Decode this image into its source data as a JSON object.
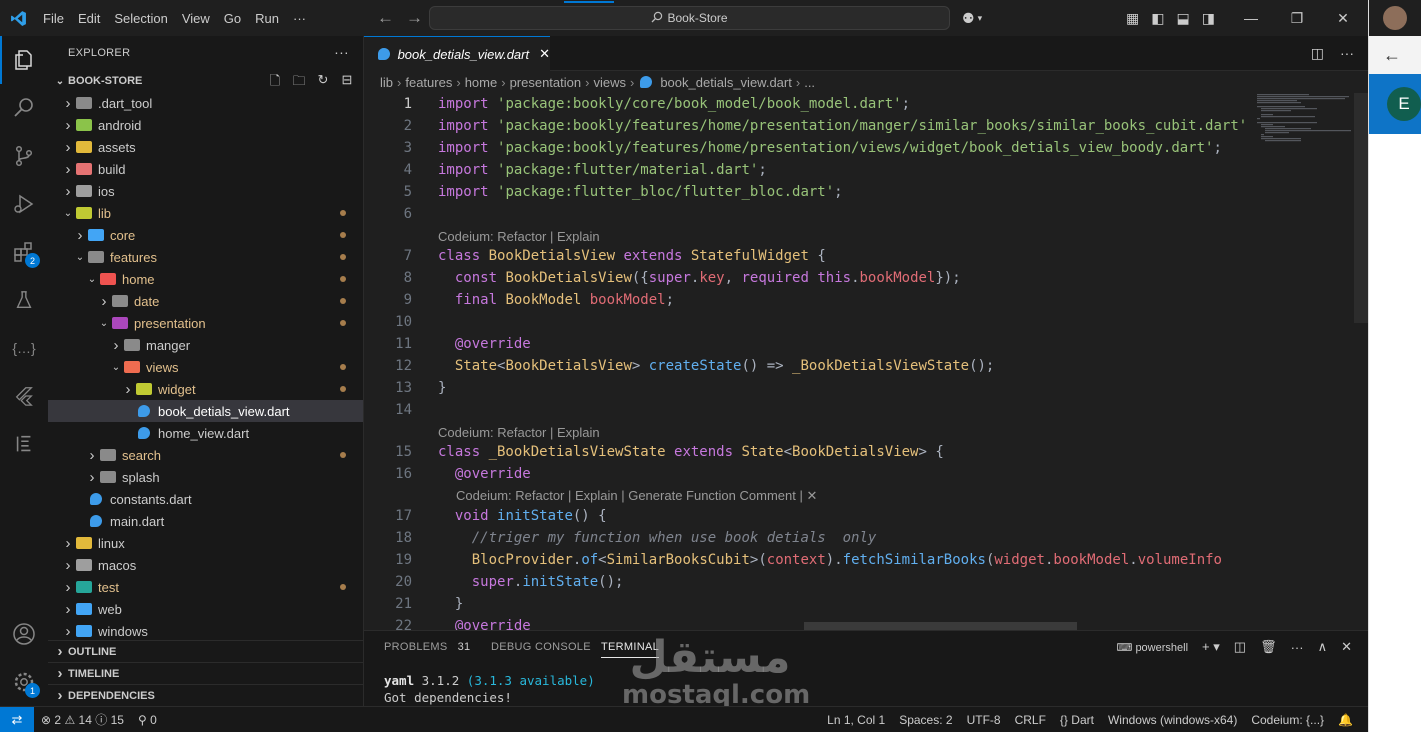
{
  "titlebar": {
    "menus": [
      "File",
      "Edit",
      "Selection",
      "View",
      "Go",
      "Run",
      "···"
    ],
    "search_text": "Book-Store"
  },
  "activity_bar": {
    "items": [
      "explorer-icon",
      "search-icon",
      "source-control-icon",
      "run-debug-icon",
      "extensions-icon",
      "testing-icon",
      "json-icon",
      "flutter-icon",
      "outline-icon"
    ],
    "extensions_badge": "2",
    "settings_badge": "1"
  },
  "sidebar": {
    "title": "EXPLORER",
    "project": "BOOK-STORE",
    "tree": [
      {
        "label": ".dart_tool",
        "depth": 0,
        "type": "folder",
        "expanded": false,
        "color": "#8a8a8a",
        "dot": false
      },
      {
        "label": "android",
        "depth": 0,
        "type": "folder",
        "expanded": false,
        "color": "#8bc34a",
        "dot": false
      },
      {
        "label": "assets",
        "depth": 0,
        "type": "folder",
        "expanded": false,
        "color": "#e2b93b",
        "dot": false
      },
      {
        "label": "build",
        "depth": 0,
        "type": "folder",
        "expanded": false,
        "color": "#e57373",
        "dot": false
      },
      {
        "label": "ios",
        "depth": 0,
        "type": "folder",
        "expanded": false,
        "color": "#9e9e9e",
        "dot": false
      },
      {
        "label": "lib",
        "depth": 0,
        "type": "folder",
        "expanded": true,
        "color": "#c0ca33",
        "dot": true,
        "modified": true
      },
      {
        "label": "core",
        "depth": 1,
        "type": "folder",
        "expanded": false,
        "color": "#42a5f5",
        "dot": true,
        "modified": true
      },
      {
        "label": "features",
        "depth": 1,
        "type": "folder",
        "expanded": true,
        "color": "#8a8a8a",
        "dot": true,
        "modified": true
      },
      {
        "label": "home",
        "depth": 2,
        "type": "folder",
        "expanded": true,
        "color": "#ef5350",
        "dot": true,
        "modified": true
      },
      {
        "label": "date",
        "depth": 3,
        "type": "folder",
        "expanded": false,
        "color": "#8a8a8a",
        "dot": true,
        "modified": true
      },
      {
        "label": "presentation",
        "depth": 3,
        "type": "folder",
        "expanded": true,
        "color": "#ab47bc",
        "dot": true,
        "modified": true
      },
      {
        "label": "manger",
        "depth": 4,
        "type": "folder",
        "expanded": false,
        "color": "#8a8a8a",
        "dot": false
      },
      {
        "label": "views",
        "depth": 4,
        "type": "folder",
        "expanded": true,
        "color": "#ef6c50",
        "dot": true,
        "modified": true
      },
      {
        "label": "widget",
        "depth": 5,
        "type": "folder",
        "expanded": false,
        "color": "#c0ca33",
        "dot": true,
        "modified": true
      },
      {
        "label": "book_detials_view.dart",
        "depth": 5,
        "type": "dart",
        "selected": true,
        "dot": false
      },
      {
        "label": "home_view.dart",
        "depth": 5,
        "type": "dart",
        "dot": false
      },
      {
        "label": "search",
        "depth": 2,
        "type": "folder",
        "expanded": false,
        "color": "#8a8a8a",
        "dot": true,
        "modified": true
      },
      {
        "label": "splash",
        "depth": 2,
        "type": "folder",
        "expanded": false,
        "color": "#8a8a8a",
        "dot": false
      },
      {
        "label": "constants.dart",
        "depth": 1,
        "type": "dart",
        "dot": false
      },
      {
        "label": "main.dart",
        "depth": 1,
        "type": "dart",
        "dot": false
      },
      {
        "label": "linux",
        "depth": 0,
        "type": "folder",
        "expanded": false,
        "color": "#e2b93b",
        "dot": false
      },
      {
        "label": "macos",
        "depth": 0,
        "type": "folder",
        "expanded": false,
        "color": "#9e9e9e",
        "dot": false
      },
      {
        "label": "test",
        "depth": 0,
        "type": "folder",
        "expanded": false,
        "color": "#26a69a",
        "dot": true,
        "modified": true
      },
      {
        "label": "web",
        "depth": 0,
        "type": "folder",
        "expanded": false,
        "color": "#42a5f5",
        "dot": false
      },
      {
        "label": "windows",
        "depth": 0,
        "type": "folder",
        "expanded": false,
        "color": "#42a5f5",
        "dot": false
      }
    ],
    "sections": [
      "OUTLINE",
      "TIMELINE",
      "DEPENDENCIES"
    ]
  },
  "editor": {
    "tab_label": "book_detials_view.dart",
    "breadcrumb": [
      "lib",
      "features",
      "home",
      "presentation",
      "views",
      "book_detials_view.dart",
      "..."
    ],
    "lines": [
      {
        "n": "1",
        "tokens": [
          [
            "kw",
            "import "
          ],
          [
            "str",
            "'package:bookly/core/book_model/book_model.dart'"
          ],
          [
            "pun",
            ";"
          ]
        ]
      },
      {
        "n": "2",
        "tokens": [
          [
            "kw",
            "import "
          ],
          [
            "str",
            "'package:bookly/features/home/presentation/manger/similar_books/similar_books_cubit.dart'"
          ]
        ]
      },
      {
        "n": "3",
        "tokens": [
          [
            "kw",
            "import "
          ],
          [
            "str",
            "'package:bookly/features/home/presentation/views/widget/book_detials_view_boody.dart'"
          ],
          [
            "pun",
            ";"
          ]
        ]
      },
      {
        "n": "4",
        "tokens": [
          [
            "kw",
            "import "
          ],
          [
            "str",
            "'package:flutter/material.dart'"
          ],
          [
            "pun",
            ";"
          ]
        ]
      },
      {
        "n": "5",
        "tokens": [
          [
            "kw",
            "import "
          ],
          [
            "str",
            "'package:flutter_bloc/flutter_bloc.dart'"
          ],
          [
            "pun",
            ";"
          ]
        ]
      },
      {
        "n": "6",
        "tokens": []
      },
      {
        "n": "7",
        "tokens": [
          [
            "kw",
            "class "
          ],
          [
            "cls",
            "BookDetialsView "
          ],
          [
            "kw",
            "extends "
          ],
          [
            "cls",
            "StatefulWidget "
          ],
          [
            "pun",
            "{"
          ]
        ]
      },
      {
        "n": "8",
        "tokens": [
          [
            "pun",
            "  "
          ],
          [
            "kw",
            "const "
          ],
          [
            "cls",
            "BookDetialsView"
          ],
          [
            "pun",
            "({"
          ],
          [
            "kw",
            "super"
          ],
          [
            "pun",
            "."
          ],
          [
            "prm",
            "key"
          ],
          [
            "pun",
            ", "
          ],
          [
            "kw",
            "required "
          ],
          [
            "kw",
            "this"
          ],
          [
            "pun",
            "."
          ],
          [
            "prm",
            "bookModel"
          ],
          [
            "pun",
            "});"
          ]
        ]
      },
      {
        "n": "9",
        "tokens": [
          [
            "pun",
            "  "
          ],
          [
            "kw",
            "final "
          ],
          [
            "cls",
            "BookModel "
          ],
          [
            "prm",
            "bookModel"
          ],
          [
            "pun",
            ";"
          ]
        ]
      },
      {
        "n": "10",
        "tokens": []
      },
      {
        "n": "11",
        "tokens": [
          [
            "pun",
            "  "
          ],
          [
            "ann",
            "@override"
          ]
        ]
      },
      {
        "n": "12",
        "tokens": [
          [
            "pun",
            "  "
          ],
          [
            "cls",
            "State"
          ],
          [
            "pun",
            "<"
          ],
          [
            "cls",
            "BookDetialsView"
          ],
          [
            "pun",
            "> "
          ],
          [
            "fn",
            "createState"
          ],
          [
            "pun",
            "() => "
          ],
          [
            "cls",
            "_BookDetialsViewState"
          ],
          [
            "pun",
            "();"
          ]
        ]
      },
      {
        "n": "13",
        "tokens": [
          [
            "pun",
            "}"
          ]
        ]
      },
      {
        "n": "14",
        "tokens": []
      },
      {
        "n": "15",
        "tokens": [
          [
            "kw",
            "class "
          ],
          [
            "cls",
            "_BookDetialsViewState "
          ],
          [
            "kw",
            "extends "
          ],
          [
            "cls",
            "State"
          ],
          [
            "pun",
            "<"
          ],
          [
            "cls",
            "BookDetialsView"
          ],
          [
            "pun",
            "> {"
          ]
        ]
      },
      {
        "n": "16",
        "tokens": [
          [
            "pun",
            "  "
          ],
          [
            "ann",
            "@override"
          ]
        ]
      },
      {
        "n": "17",
        "tokens": [
          [
            "pun",
            "  "
          ],
          [
            "kw",
            "void "
          ],
          [
            "fn",
            "initState"
          ],
          [
            "pun",
            "() {"
          ]
        ]
      },
      {
        "n": "18",
        "tokens": [
          [
            "pun",
            "    "
          ],
          [
            "cmt",
            "//triger my function when use book detials  only"
          ]
        ]
      },
      {
        "n": "19",
        "tokens": [
          [
            "pun",
            "    "
          ],
          [
            "cls",
            "BlocProvider"
          ],
          [
            "pun",
            "."
          ],
          [
            "fn",
            "of"
          ],
          [
            "pun",
            "<"
          ],
          [
            "cls",
            "SimilarBooksCubit"
          ],
          [
            "pun",
            ">("
          ],
          [
            "prm",
            "context"
          ],
          [
            "pun",
            ")."
          ],
          [
            "fn",
            "fetchSimilarBooks"
          ],
          [
            "pun",
            "("
          ],
          [
            "prm",
            "widget"
          ],
          [
            "pun",
            "."
          ],
          [
            "prm",
            "bookModel"
          ],
          [
            "pun",
            "."
          ],
          [
            "prm",
            "volumeInfo"
          ]
        ]
      },
      {
        "n": "20",
        "tokens": [
          [
            "pun",
            "    "
          ],
          [
            "kw",
            "super"
          ],
          [
            "pun",
            "."
          ],
          [
            "fn",
            "initState"
          ],
          [
            "pun",
            "();"
          ]
        ]
      },
      {
        "n": "21",
        "tokens": [
          [
            "pun",
            "  }"
          ]
        ]
      },
      {
        "n": "22",
        "tokens": [
          [
            "pun",
            "  "
          ],
          [
            "ann",
            "@override"
          ]
        ]
      }
    ],
    "codelens": [
      {
        "after_line": "6",
        "text": "Codeium: Refactor | Explain",
        "indent": 0
      },
      {
        "after_line": "14",
        "text": "Codeium: Refactor | Explain",
        "indent": 0
      },
      {
        "after_line": "16",
        "text": "Codeium: Refactor | Explain | Generate Function Comment | ✕",
        "indent": 1
      }
    ]
  },
  "panel": {
    "tabs": [
      "PROBLEMS",
      "DEBUG CONSOLE",
      "TERMINAL"
    ],
    "problems_count": "31",
    "shell": "powershell",
    "terminal_lines": [
      {
        "prefix": "yaml",
        "text": " 3.1.2 ",
        "note": "(3.1.3 available)"
      },
      {
        "prefix": "",
        "text": "Got dependencies!",
        "note": ""
      }
    ]
  },
  "statusbar": {
    "errors": "2",
    "warnings": "14",
    "infos": "15",
    "ports": "0",
    "position": "Ln 1, Col 1",
    "spaces": "Spaces: 2",
    "encoding": "UTF-8",
    "eol": "CRLF",
    "language": "Dart",
    "platform": "Windows (windows-x64)",
    "codeium": "Codeium: {...}"
  },
  "right_panel": {
    "avatar_letter": "E"
  },
  "watermark": {
    "arabic": "مستقل",
    "latin": "mostaql.com"
  },
  "colors": {
    "accent": "#0078d4",
    "modified_dot": "#a67d4c"
  }
}
